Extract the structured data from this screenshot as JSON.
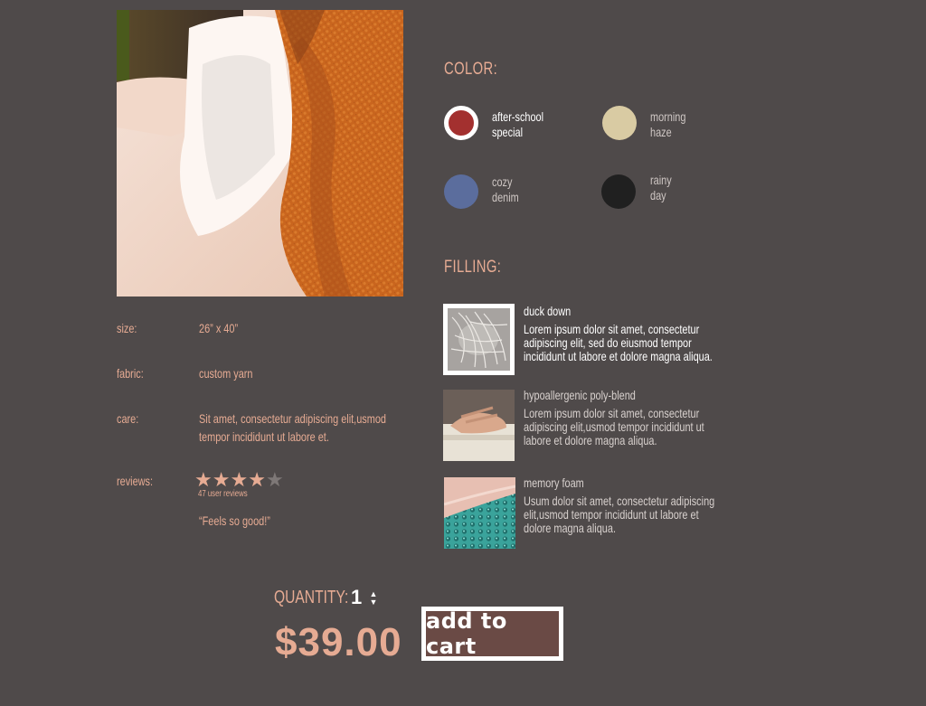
{
  "product": {
    "photo_alt": "pillow photo"
  },
  "specs": {
    "size_label": "size:",
    "size_value": "26” x 40”",
    "fabric_label": "fabric:",
    "fabric_value": "custom yarn",
    "care_label": "care:",
    "care_value": "Sit amet, consectetur adipiscing elit,usmod tempor incididunt ut labore et.",
    "reviews_label": "reviews:",
    "rating": 4,
    "rating_max": 5,
    "reviews_count": "47 user reviews",
    "quote": "“Feels so good!”"
  },
  "color": {
    "title": "COLOR:",
    "options": [
      {
        "line1": "after-school",
        "line2": "special",
        "hex": "#a3302f",
        "selected": true
      },
      {
        "line1": "morning",
        "line2": "haze",
        "hex": "#d9cba3",
        "selected": false
      },
      {
        "line1": "cozy",
        "line2": "denim",
        "hex": "#5b6d9d",
        "selected": false
      },
      {
        "line1": "rainy",
        "line2": "day",
        "hex": "#202020",
        "selected": false
      }
    ]
  },
  "filling": {
    "title": "FILLING:",
    "options": [
      {
        "name": "duck down",
        "desc": "Lorem ipsum dolor sit amet, consectetur adipiscing elit, sed do eiusmod tempor incididunt ut labore et dolore magna aliqua.",
        "selected": true
      },
      {
        "name": "hypoallergenic poly-blend",
        "desc": "Lorem ipsum dolor sit amet, consectetur adipiscing elit,usmod tempor incididunt ut labore et dolore magna aliqua.",
        "selected": false
      },
      {
        "name": "memory foam",
        "desc": "Usum dolor sit amet, consectetur adipiscing elit,usmod tempor incididunt ut labore et dolore magna aliqua.",
        "selected": false
      }
    ]
  },
  "purchase": {
    "quantity_label": "QUANTITY:",
    "quantity_value": "1",
    "price": "$39.00",
    "add_to_cart_label": "add to cart"
  },
  "colors": {
    "background": "#4f4a4a",
    "accent": "#e6ab93",
    "button_bg": "#6a4a45"
  }
}
